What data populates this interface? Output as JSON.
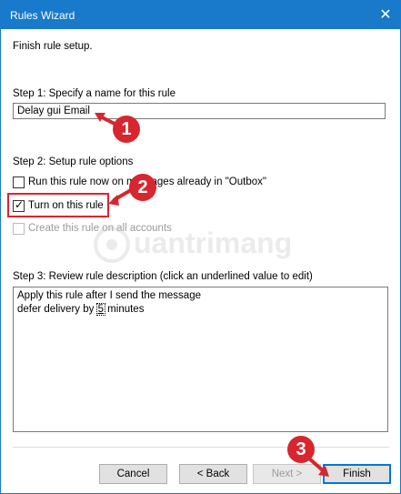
{
  "window": {
    "title": "Rules Wizard",
    "close_icon": "close-icon"
  },
  "header": {
    "subtitle": "Finish rule setup."
  },
  "step1": {
    "label": "Step 1: Specify a name for this rule",
    "value": "Delay gui Email"
  },
  "step2": {
    "label": "Step 2: Setup rule options",
    "options": [
      {
        "label": "Run this rule now on messages already in \"Outbox\"",
        "checked": false,
        "enabled": true
      },
      {
        "label": "Turn on this rule",
        "checked": true,
        "enabled": true
      },
      {
        "label": "Create this rule on all accounts",
        "checked": false,
        "enabled": false
      }
    ]
  },
  "step3": {
    "label": "Step 3: Review rule description (click an underlined value to edit)",
    "line1": "Apply this rule after I send the message",
    "line2_prefix": "defer delivery by",
    "line2_value": "5",
    "line2_suffix": " minutes"
  },
  "buttons": {
    "cancel": "Cancel",
    "back": "< Back",
    "next": "Next >",
    "finish": "Finish"
  },
  "annotations": {
    "badge1": "1",
    "badge2": "2",
    "badge3": "3",
    "color": "#d7262f"
  },
  "watermark": {
    "text": "uantrimang"
  }
}
